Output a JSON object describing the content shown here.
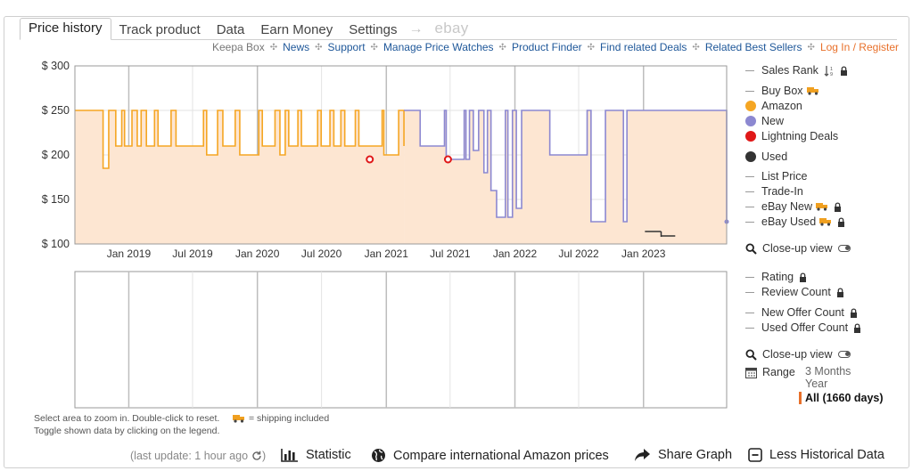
{
  "tabs": [
    {
      "label": "Price history",
      "active": true
    },
    {
      "label": "Track product"
    },
    {
      "label": "Data"
    },
    {
      "label": "Earn Money"
    },
    {
      "label": "Settings"
    }
  ],
  "tab_arrow": "→",
  "tab_ebay": "ebay",
  "subnav": {
    "keepa_box": "Keepa Box",
    "news": "News",
    "support": "Support",
    "manage": "Manage Price Watches",
    "finder": "Product Finder",
    "deals": "Find related Deals",
    "bestsellers": "Related Best Sellers",
    "login": "Log In / Register",
    "sep": "✣"
  },
  "legend": {
    "sales_rank": "Sales Rank",
    "buy_box": "Buy Box",
    "amazon": "Amazon",
    "new": "New",
    "lightning": "Lightning Deals",
    "used": "Used",
    "list_price": "List Price",
    "trade_in": "Trade-In",
    "ebay_new": "eBay New",
    "ebay_used": "eBay Used",
    "closeup1": "Close-up view",
    "rating": "Rating",
    "review_count": "Review Count",
    "new_offer": "New Offer Count",
    "used_offer": "Used Offer Count",
    "closeup2": "Close-up view",
    "range": "Range",
    "range_3m": "3 Months",
    "range_year": "Year",
    "range_all": "All (1660 days)"
  },
  "colors": {
    "amazon": "#f5a623",
    "new": "#8c88d1",
    "lightning": "#e01818",
    "used": "#333333",
    "fill": "#fde6d2",
    "link": "#1e5799",
    "accent": "#e8702a"
  },
  "notes": {
    "line1": "Select area to zoom in. Double-click to reset.",
    "line2": "Toggle shown data by clicking on the legend.",
    "shipping": "= shipping included"
  },
  "bottom": {
    "last_update": "(last update: 1 hour ago",
    "last_update_end": ")",
    "statistic": "Statistic",
    "compare": "Compare international Amazon prices",
    "share": "Share Graph",
    "less": "Less Historical Data"
  },
  "chart_data": {
    "type": "line",
    "ylabels": [
      "$ 300",
      "$ 250",
      "$ 200",
      "$ 150",
      "$ 100"
    ],
    "yticks": [
      300,
      250,
      200,
      150,
      100
    ],
    "ylim": [
      100,
      300
    ],
    "xlim": [
      "2018-08-01",
      "2023-08-25"
    ],
    "xtick_labels": [
      "Jan 2019",
      "Jul 2019",
      "Jan 2020",
      "Jul 2020",
      "Jan 2021",
      "Jul 2021",
      "Jan 2022",
      "Jul 2022",
      "Jan 2023"
    ],
    "xtick_dates": [
      "2019-01-01",
      "2019-07-01",
      "2020-01-01",
      "2020-07-01",
      "2021-01-01",
      "2021-07-01",
      "2022-01-01",
      "2022-07-01",
      "2023-01-01"
    ],
    "series": [
      {
        "name": "Amazon",
        "color": "#f5a623",
        "x": [
          "2018-08-01",
          "2018-10-20",
          "2018-11-05",
          "2018-11-25",
          "2018-12-12",
          "2018-12-20",
          "2019-01-10",
          "2019-01-25",
          "2019-02-05",
          "2019-02-20",
          "2019-03-15",
          "2019-03-25",
          "2019-05-01",
          "2019-05-15",
          "2019-08-01",
          "2019-08-10",
          "2019-09-10",
          "2019-09-25",
          "2019-10-30",
          "2019-11-12",
          "2020-01-05",
          "2020-01-15",
          "2020-02-20",
          "2020-03-05",
          "2020-03-20",
          "2020-03-30",
          "2020-04-25",
          "2020-05-05",
          "2020-06-20",
          "2020-06-30",
          "2020-07-25",
          "2020-08-05",
          "2020-08-25",
          "2020-09-05",
          "2020-10-05",
          "2020-10-15",
          "2020-12-20",
          "2020-12-25",
          "2021-02-05",
          "2021-02-20"
        ],
        "y": [
          250,
          185,
          250,
          210,
          250,
          210,
          250,
          210,
          250,
          210,
          250,
          210,
          250,
          210,
          250,
          200,
          250,
          210,
          250,
          200,
          250,
          210,
          250,
          200,
          250,
          210,
          250,
          210,
          250,
          210,
          250,
          210,
          250,
          210,
          250,
          210,
          250,
          200,
          250,
          210
        ]
      },
      {
        "name": "New",
        "color": "#8c88d1",
        "x": [
          "2021-02-20",
          "2021-04-01",
          "2021-04-07",
          "2021-06-15",
          "2021-06-20",
          "2021-08-10",
          "2021-08-15",
          "2021-08-25",
          "2021-09-05",
          "2021-09-20",
          "2021-10-05",
          "2021-10-15",
          "2021-10-25",
          "2021-11-10",
          "2021-12-05",
          "2021-12-12",
          "2021-12-25",
          "2022-01-05",
          "2022-01-20",
          "2022-04-05",
          "2022-04-10",
          "2022-04-20",
          "2022-05-05",
          "2022-05-15",
          "2022-06-05",
          "2022-06-20",
          "2022-07-25",
          "2022-08-05",
          "2022-09-15",
          "2022-11-05",
          "2022-11-15",
          "2022-12-05",
          "2023-08-25"
        ],
        "y": [
          250,
          250,
          210,
          250,
          195,
          250,
          195,
          250,
          205,
          250,
          180,
          250,
          160,
          130,
          250,
          130,
          250,
          140,
          250,
          250,
          200,
          200,
          200,
          200,
          200,
          200,
          250,
          125,
          250,
          125,
          250,
          250,
          125
        ]
      }
    ],
    "lightning_deals": [
      {
        "x": "2020-11-15",
        "y": 195
      },
      {
        "x": "2021-06-25",
        "y": 195
      }
    ],
    "used_segments": [
      {
        "x": [
          "2023-01-05",
          "2023-02-20"
        ],
        "y": [
          114,
          114
        ]
      },
      {
        "x": [
          "2023-02-20",
          "2023-04-01"
        ],
        "y": [
          109,
          109
        ]
      }
    ]
  }
}
